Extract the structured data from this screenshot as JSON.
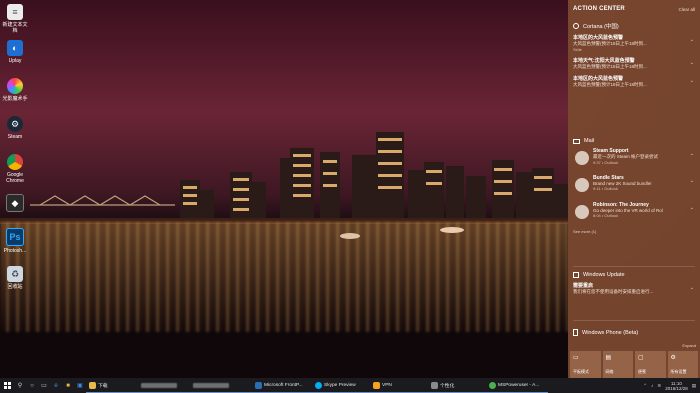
{
  "desktop": {
    "icons": [
      {
        "label": "新建文本文档",
        "icon": "text-document-icon",
        "color": "#e8e8e8"
      },
      {
        "label": "Uplay",
        "icon": "uplay-icon",
        "color": "#1d6fd1"
      },
      {
        "label": "光影魔术手",
        "icon": "photo-editor-icon",
        "color": "#f2b01e"
      },
      {
        "label": "Steam",
        "icon": "steam-icon",
        "color": "#1b2838"
      },
      {
        "label": "Google Chrome",
        "icon": "chrome-icon",
        "color": "#4caf50"
      },
      {
        "label": "",
        "icon": "app-icon",
        "color": "#2a2a2a"
      },
      {
        "label": "Photosh...",
        "icon": "photoshop-icon",
        "color": "#0a3a66"
      },
      {
        "label": "回收站",
        "icon": "recycle-bin-icon",
        "color": "#cfd8e0"
      }
    ]
  },
  "action_center": {
    "title": "ACTION CENTER",
    "clear_all": "Clear all",
    "cortana": {
      "header": "Cortana (中国)",
      "notifications": [
        {
          "title": "本地区的大风蓝色预警",
          "body": "大风蓝色预警(预计18日上午18时到...",
          "meta": "Sidle"
        },
        {
          "title": "本地天气:沈阳大风蓝色预警",
          "body": "大风蓝色预警(预计18日上午18时到...",
          "meta": ""
        },
        {
          "title": "本地区的大风蓝色预警",
          "body": "大风蓝色预警(预计18日上午18时到...",
          "meta": ""
        }
      ]
    },
    "mail": {
      "header": "Mail",
      "items": [
        {
          "title": "Steam Support",
          "body": "最近一次的 Steam 帐户登录尝试",
          "meta": "9:37 • Outlook"
        },
        {
          "title": "Bundle Stars",
          "body": "Brand new 2K Sound bundle!",
          "meta": "9:11 • Outlook"
        },
        {
          "title": "Robinson: The Journey",
          "body": "Go deeper into the VR world of Rol",
          "meta": "8:04 • Outlook"
        }
      ],
      "see_more": "See more (1)"
    },
    "windows_update": {
      "header": "Windows Update",
      "title": "需要重启",
      "body": "我们将在您不使用设备时安排重启进行...",
      "expand": "⌄"
    },
    "windows_phone": {
      "header": "Windows Phone (Beta)",
      "expand": "Expand"
    },
    "quick_actions": [
      {
        "label": "平板模式",
        "icon": "tablet-mode-icon"
      },
      {
        "label": "网络",
        "icon": "network-icon"
      },
      {
        "label": "便笺",
        "icon": "note-icon"
      },
      {
        "label": "所有设置",
        "icon": "settings-icon"
      }
    ]
  },
  "taskbar": {
    "apps": [
      {
        "label": "下载",
        "icon": "folder-icon",
        "color": "#e8b84a"
      },
      {
        "label": "",
        "icon": "app-icon",
        "color": "#6f6f6f"
      },
      {
        "label": "",
        "icon": "app-icon",
        "color": "#6f6f6f"
      },
      {
        "label": "Microsoft FrontP...",
        "icon": "frontpage-icon",
        "color": "#2c6db5"
      },
      {
        "label": "Skype Preview",
        "icon": "skype-icon",
        "color": "#00aff0"
      },
      {
        "label": "VPN",
        "icon": "vpn-icon",
        "color": "#f6a21d"
      },
      {
        "label": "个性化",
        "icon": "personalize-icon",
        "color": "#8a8a8a"
      },
      {
        "label": "MSPoweruser - A...",
        "icon": "chrome-icon",
        "color": "#4caf50"
      }
    ],
    "clock": {
      "time": "11:10",
      "date": "2016/12/28"
    }
  }
}
